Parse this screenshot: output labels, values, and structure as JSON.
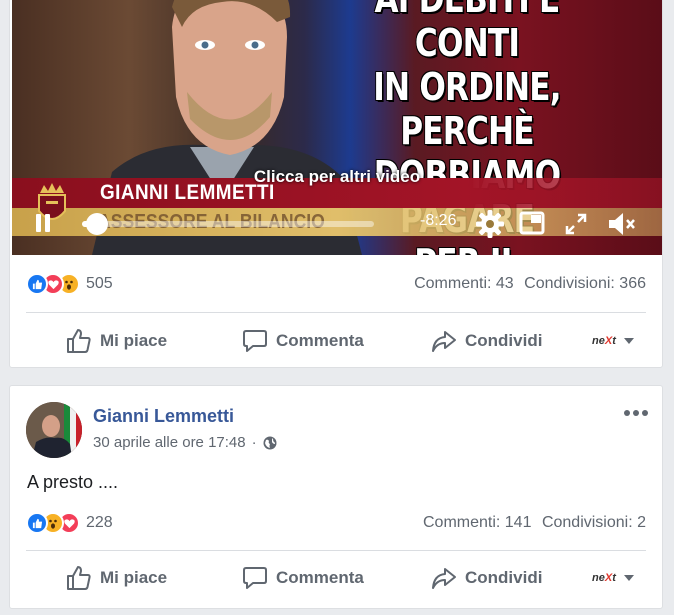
{
  "video_post": {
    "headline": [
      "AI DEBITI E CONTI",
      "IN ORDINE, PERCHÈ",
      "DOBBIAMO PAGARE",
      "PER IL PASSATO?"
    ],
    "speaker_name": "GIANNI LEMMETTI",
    "speaker_role": "ASSESSORE AL BILANCIO",
    "more_videos": "Clicca per altri video",
    "time_remaining": "-8:26",
    "progress_fraction": 0.05,
    "reactions": {
      "icons": [
        "like-icon",
        "love-icon",
        "wow-icon"
      ],
      "count": "505"
    },
    "comments": "Commenti: 43",
    "shares": "Condivisioni: 366"
  },
  "text_post": {
    "author": "Gianni Lemmetti",
    "timestamp": "30 aprile alle ore 17:48",
    "separator": "·",
    "privacy_icon": "globe-icon",
    "body": "A presto ....",
    "reactions": {
      "icons": [
        "like-icon",
        "wow-icon",
        "love-icon"
      ],
      "count": "228"
    },
    "comments": "Commenti: 141",
    "shares": "Condivisioni: 2"
  },
  "actions": {
    "like": "Mi piace",
    "comment": "Commenta",
    "share": "Condividi",
    "next_logo_a": "ne",
    "next_logo_b": "X",
    "next_logo_c": "t"
  },
  "colors": {
    "like_blue": "#1877f2",
    "love_red": "#f33e58",
    "wow_yellow": "#f7b125",
    "author_link": "#385898"
  }
}
